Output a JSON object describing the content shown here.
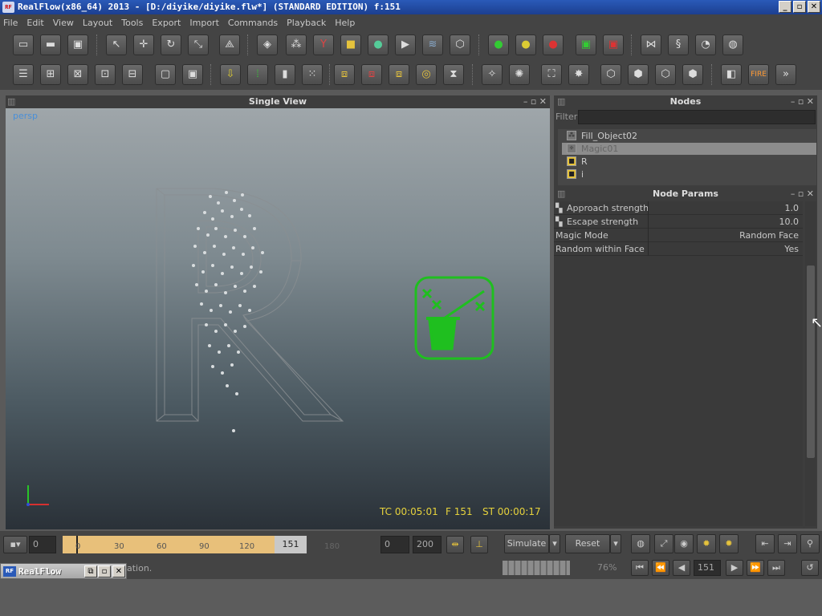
{
  "window": {
    "app_icon": "RF",
    "title": "RealFlow(x86_64) 2013 - [D:/diyike/diyike.flw*] (STANDARD EDITION) f:151",
    "minimize": "_",
    "maximize": "▫",
    "close": "✕"
  },
  "menu": [
    "File",
    "Edit",
    "View",
    "Layout",
    "Tools",
    "Export",
    "Import",
    "Commands",
    "Playback",
    "Help"
  ],
  "single_view": {
    "title": "Single View",
    "camera_label": "persp",
    "tc": "TC 00:05:01",
    "frame": "F 151",
    "st": "ST 00:00:17"
  },
  "nodes_panel": {
    "title": "Nodes",
    "filter_label": "Filter",
    "filter_value": "",
    "items": [
      {
        "label": "Fill_Object02",
        "icon": "emitter-icon"
      },
      {
        "label": "Magic01",
        "icon": "daemon-icon"
      },
      {
        "label": "R",
        "icon": "object-icon"
      },
      {
        "label": "i",
        "icon": "object-icon"
      }
    ]
  },
  "node_params": {
    "title": "Node Params",
    "rows": [
      {
        "label": "Approach strength",
        "value": "1.0"
      },
      {
        "label": "Escape strength",
        "value": "10.0"
      },
      {
        "label": "Magic Mode",
        "value": "Random Face"
      },
      {
        "label": "Random within Face",
        "value": "Yes"
      }
    ]
  },
  "timeline": {
    "start": "0",
    "ticks": [
      "0",
      "30",
      "60",
      "90",
      "120"
    ],
    "current": "151",
    "beyond_tick": "180",
    "range_start": "0",
    "range_end": "200",
    "simulate_label": "Simulate",
    "reset_label": "Reset"
  },
  "status": {
    "message": "ation.",
    "progress": "76%",
    "frame_field": "151"
  },
  "minimized_window": {
    "icon": "RF",
    "title": "RealFlow"
  },
  "accent_colors": {
    "timeline_range": "#e8c07a",
    "daemon_icon": "#1fbf1f",
    "readout": "#e6d23c"
  }
}
